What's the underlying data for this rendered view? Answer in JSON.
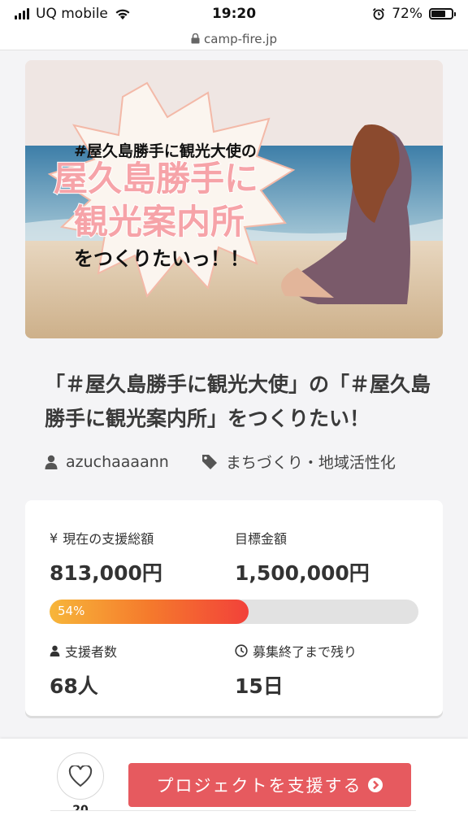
{
  "status_bar": {
    "carrier": "UQ mobile",
    "time": "19:20",
    "battery": "72%",
    "battery_level": 0.72
  },
  "browser": {
    "url": "camp-fire.jp"
  },
  "hero": {
    "small_text": "#屋久島勝手に観光大使の",
    "big_line1": "屋久島勝手に",
    "big_line2": "観光案内所",
    "bottom_text": "をつくりたいっ！！"
  },
  "project": {
    "title": "「＃屋久島勝手に観光大使」の「＃屋久島勝手に観光案内所」をつくりたい！",
    "author": "azuchaaaann",
    "category": "まちづくり・地域活性化"
  },
  "stats": {
    "current_label": "現在の支援総額",
    "current_value": "813,000円",
    "goal_label": "目標金額",
    "goal_value": "1,500,000円",
    "progress_text": "54%",
    "progress": 0.54,
    "supporters_label": "支援者数",
    "supporters_value": "68人",
    "remaining_label": "募集終了まで残り",
    "remaining_value": "15日"
  },
  "actions": {
    "favorite_count": "20",
    "support_label": "プロジェクトを支援する"
  },
  "colors": {
    "accent": "#e65a5f",
    "progress_start": "#f7b63a",
    "progress_end": "#f2413a"
  }
}
